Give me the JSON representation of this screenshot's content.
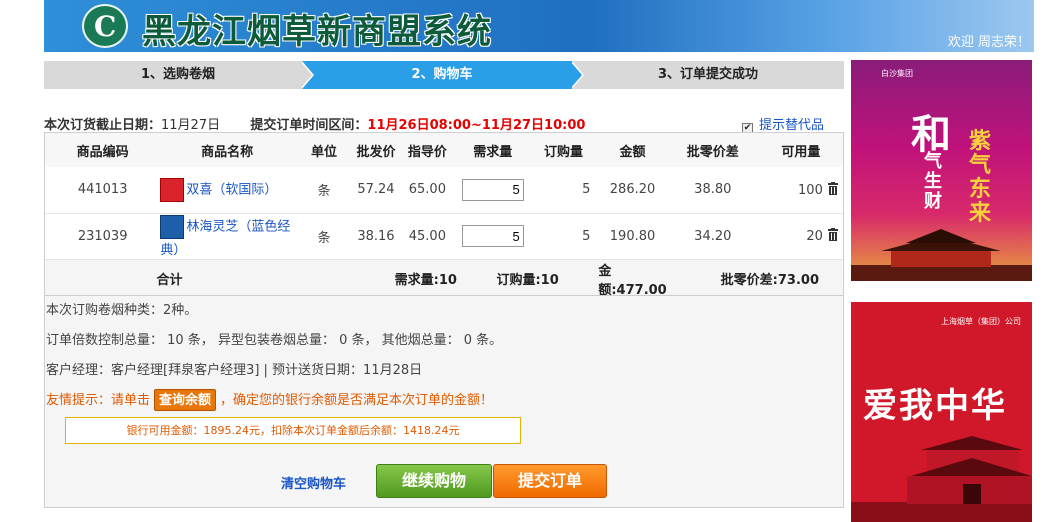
{
  "header": {
    "title": "黑龙江烟草新商盟系统",
    "welcome": "欢迎 周志荣！"
  },
  "steps": [
    {
      "label": "1、选购卷烟"
    },
    {
      "label": "2、购物车"
    },
    {
      "label": "3、订单提交成功"
    }
  ],
  "info": {
    "deadline_label": "本次订货截止日期：",
    "deadline_value": "11月27日",
    "window_label": "提交订单时间区间：",
    "window_value": "11月26日08:00~11月27日10:00",
    "substitute_label": "提示替代品"
  },
  "table": {
    "headers": [
      "商品编码",
      "商品名称",
      "单位",
      "批发价",
      "指导价",
      "需求量",
      "订购量",
      "金额",
      "批零价差",
      "可用量"
    ],
    "rows": [
      {
        "code": "441013",
        "name": "双喜（软国际）",
        "unit": "条",
        "wholesale": "57.24",
        "guide": "65.00",
        "demand": "5",
        "order": "5",
        "amount": "286.20",
        "diff": "38.80",
        "available": "100"
      },
      {
        "code": "231039",
        "name": "林海灵芝（蓝色经典）",
        "unit": "条",
        "wholesale": "38.16",
        "guide": "45.00",
        "demand": "5",
        "order": "5",
        "amount": "190.80",
        "diff": "34.20",
        "available": "20"
      }
    ],
    "total": {
      "label": "合计",
      "demand": "需求量:10",
      "order": "订购量:10",
      "amount": "金额:477.00",
      "diff": "批零价差:73.00"
    }
  },
  "notes": {
    "kinds": "本次订购卷烟种类：2种。",
    "limits": "订单倍数控制总量： 10 条， 异型包装卷烟总量： 0 条， 其他烟总量： 0 条。",
    "manager": "客户经理：客户经理[拜泉客户经理3] | 预计送货日期：11月28日",
    "tip_prefix": "友情提示：请单击",
    "tip_button": "查询余额",
    "tip_suffix": "，确定您的银行余额是否满足本次订单的金额！",
    "balance": "银行可用金额：1895.24元，扣除本次订单金额后余额：1418.24元"
  },
  "buttons": {
    "clear": "清空购物车",
    "continue": "继续购物",
    "submit": "提交订单"
  },
  "ads": {
    "ad1_brand": "白沙集团",
    "ad1_big": "和",
    "ad1_v1": "气生财",
    "ad1_v2": "紫气东来",
    "ad2_brand": "上海烟草（集团）公司",
    "ad2_big": "爱我中华"
  }
}
